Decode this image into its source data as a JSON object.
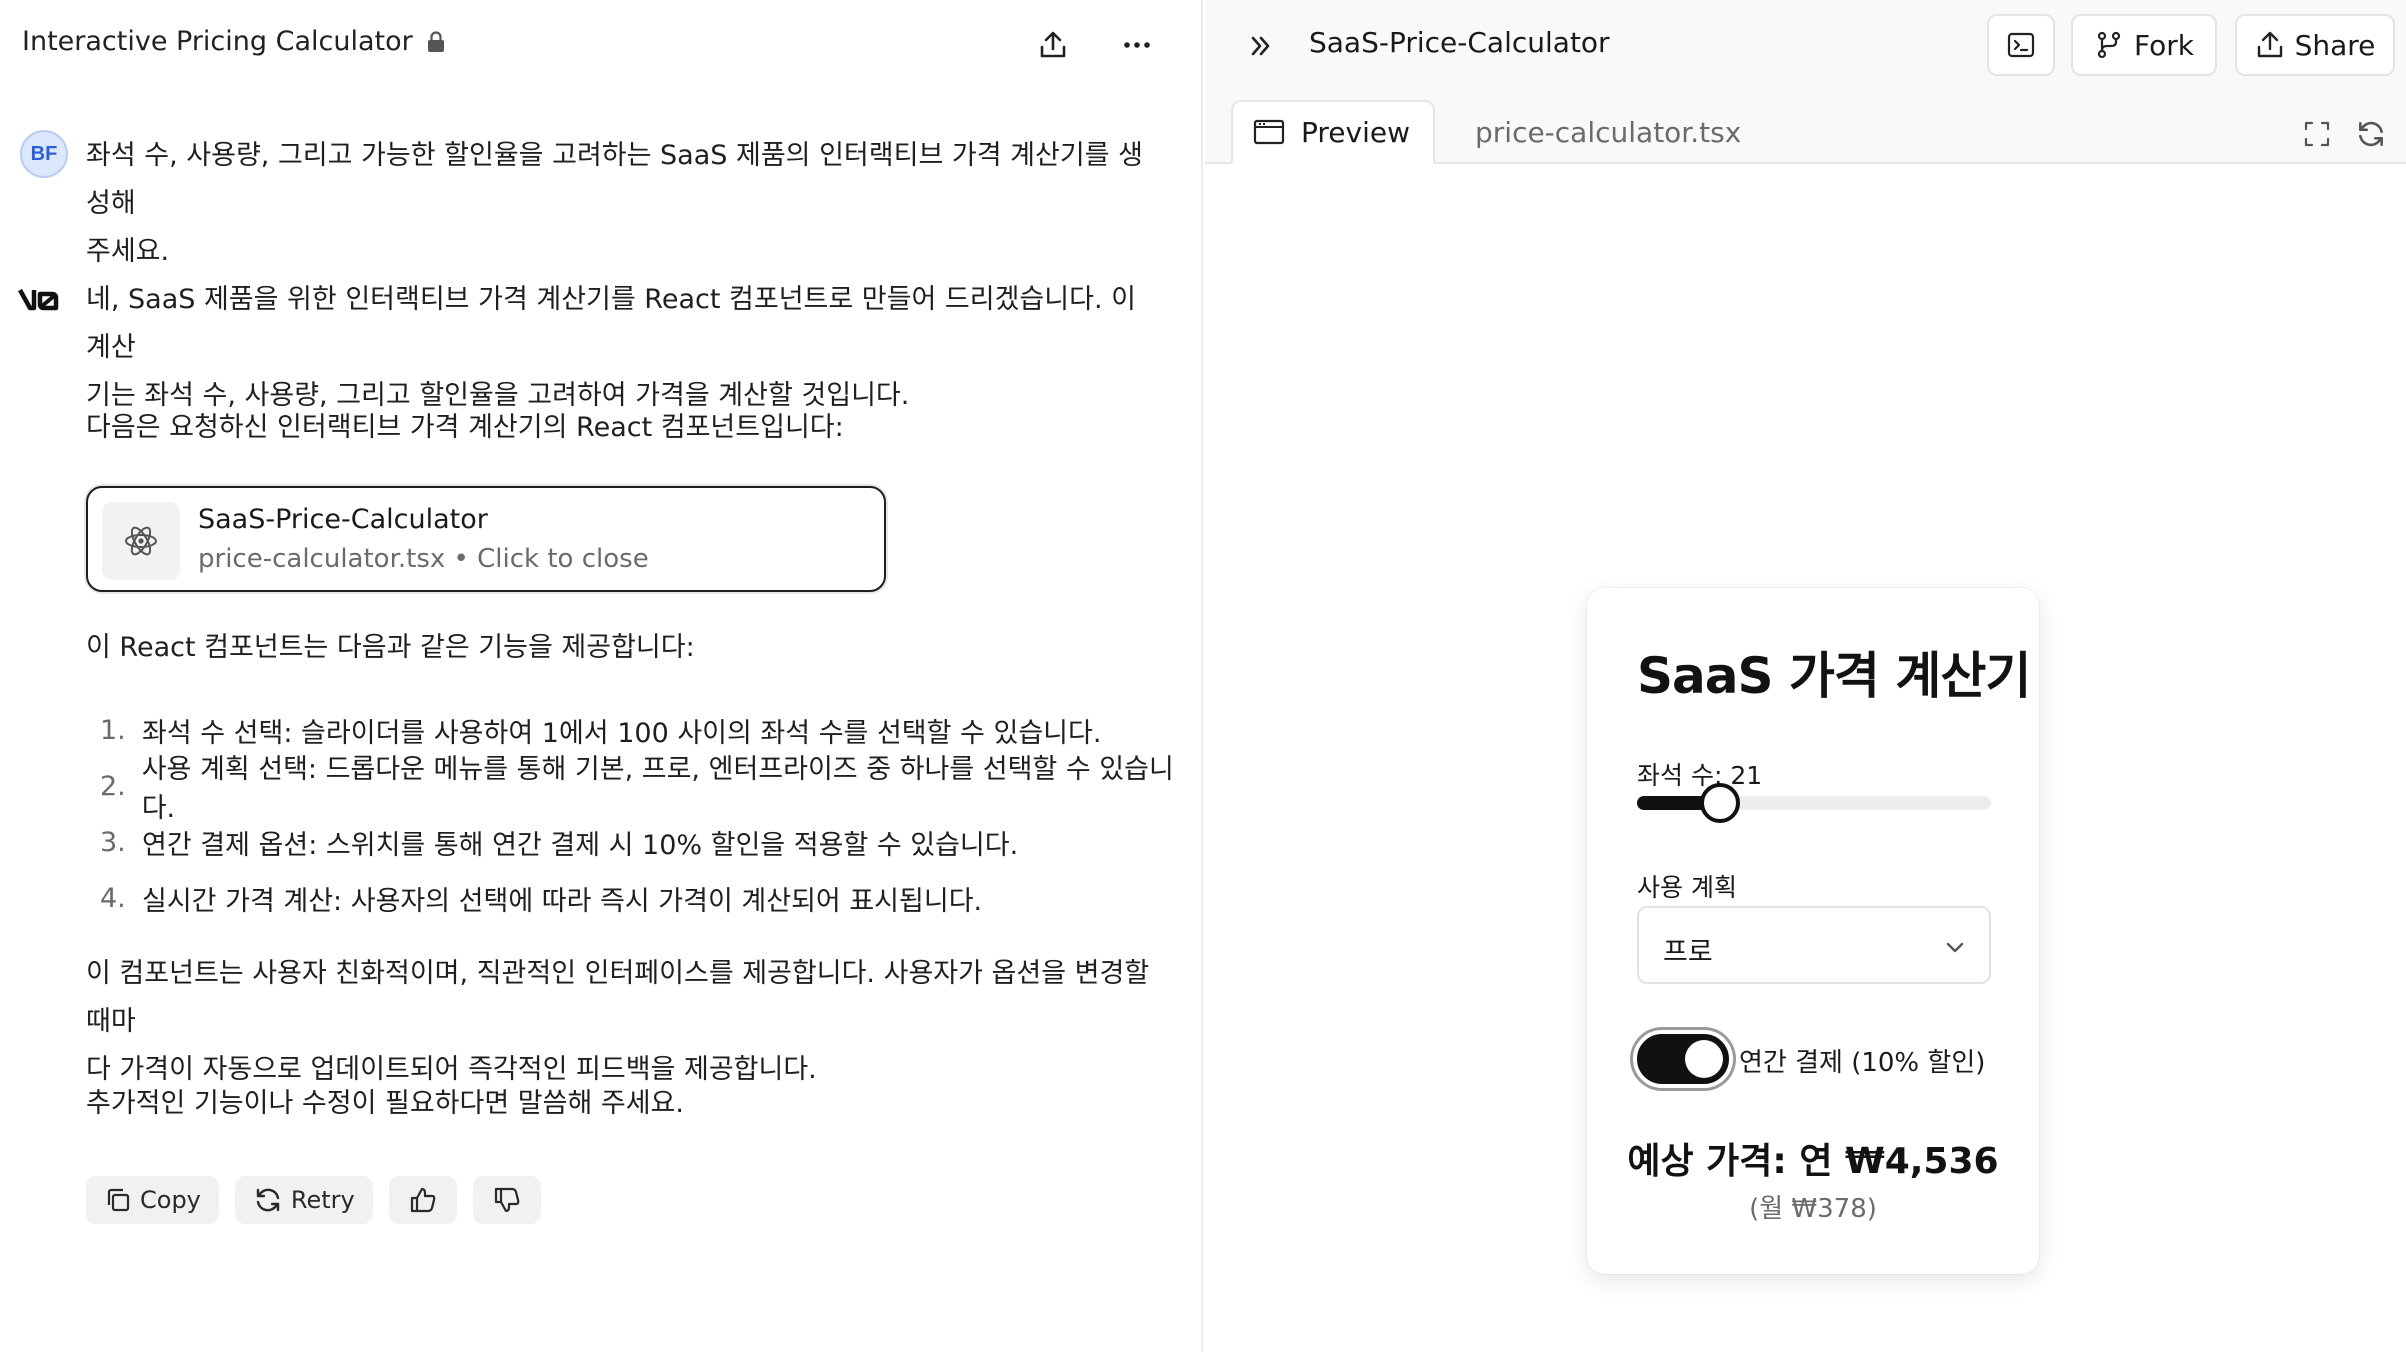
{
  "chat": {
    "title": "Interactive Pricing Calculator",
    "user_avatar": "BF",
    "user_message_line1": "좌석 수, 사용량, 그리고 가능한 할인율을 고려하는 SaaS 제품의 인터랙티브 가격 계산기를 생성해",
    "user_message_line2": "주세요.",
    "ai_intro_line1": "네, SaaS 제품을 위한 인터랙티브 가격 계산기를 React 컴포넌트로 만들어 드리겠습니다. 이 계산",
    "ai_intro_line2": "기는 좌석 수, 사용량, 그리고 할인율을 고려하여 가격을 계산할 것입니다.",
    "ai_lead": "다음은 요청하신 인터랙티브 가격 계산기의 React 컴포넌트입니다:",
    "artifact": {
      "name": "SaaS-Price-Calculator",
      "subtitle": "price-calculator.tsx • Click to close"
    },
    "features_heading": "이 React 컴포넌트는 다음과 같은 기능을 제공합니다:",
    "features": [
      {
        "num": "1.",
        "text": "좌석 수 선택: 슬라이더를 사용하여 1에서 100 사이의 좌석 수를 선택할 수 있습니다."
      },
      {
        "num": "2.",
        "text": "사용 계획 선택: 드롭다운 메뉴를 통해 기본, 프로, 엔터프라이즈 중 하나를 선택할 수 있습니다."
      },
      {
        "num": "3.",
        "text": "연간 결제 옵션: 스위치를 통해 연간 결제 시 10% 할인을 적용할 수 있습니다."
      },
      {
        "num": "4.",
        "text": "실시간 가격 계산: 사용자의 선택에 따라 즉시 가격이 계산되어 표시됩니다."
      }
    ],
    "summary_line1": "이 컴포넌트는 사용자 친화적이며, 직관적인 인터페이스를 제공합니다. 사용자가 옵션을 변경할 때마",
    "summary_line2": "다 가격이 자동으로 업데이트되어 즉각적인 피드백을 제공합니다.",
    "closing": "추가적인 기능이나 수정이 필요하다면 말씀해 주세요.",
    "actions": {
      "copy": "Copy",
      "retry": "Retry"
    }
  },
  "preview": {
    "project_title": "SaaS-Price-Calculator",
    "fork_label": "Fork",
    "share_label": "Share",
    "tabs": {
      "preview": "Preview",
      "code": "price-calculator.tsx"
    }
  },
  "calculator": {
    "title": "SaaS 가격 계산기",
    "seats_label": "좌석 수: 21",
    "seats_value": 21,
    "seats_min": 1,
    "seats_max": 100,
    "plan_label": "사용 계획",
    "plan_value": "프로",
    "annual_toggle_on": true,
    "annual_label": "연간 결제 (10% 할인)",
    "price_main": "예상 가격: 연 ₩4,536",
    "price_sub": "(월 ₩378)"
  },
  "colors": {
    "accent_dark": "#111111",
    "muted_text": "#6b6b6b",
    "border": "#e3e3e3"
  }
}
